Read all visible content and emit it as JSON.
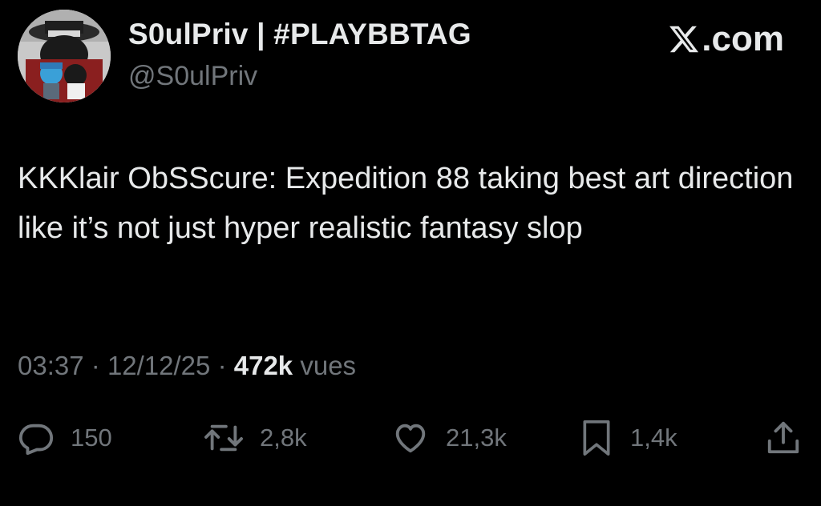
{
  "author": {
    "display_name": "S0ulPriv | #PLAYBBTAG",
    "handle": "@S0ulPriv",
    "avatar_icon": "profile-avatar-image"
  },
  "brand": {
    "text": ".com",
    "logo_icon": "x-logo-icon"
  },
  "tweet": {
    "text": "KKKlair ObSScure: Expedition 88 taking best art direction like it’s not just hyper realistic fantasy slop"
  },
  "meta": {
    "time": "03:37",
    "separator": "·",
    "date": "12/12/25",
    "views_count": "472k",
    "views_label": "vues"
  },
  "actions": {
    "replies": "150",
    "reposts": "2,8k",
    "likes": "21,3k",
    "bookmarks": "1,4k"
  },
  "colors": {
    "background": "#000000",
    "primary_text": "#e7e9ea",
    "secondary_text": "#71767b"
  }
}
